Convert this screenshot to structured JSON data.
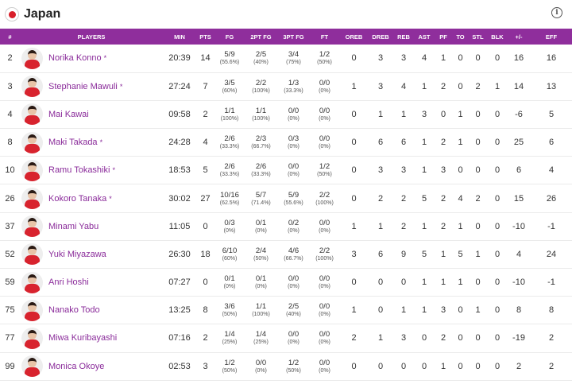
{
  "team": {
    "name": "Japan",
    "flag_icon": "japan-flag-icon",
    "flag_color": "#d81f2a"
  },
  "info_glyph": "i",
  "accent_color": "#8f2e9c",
  "headers": [
    "#",
    "PLAYERS",
    "MIN",
    "PTS",
    "FG",
    "2PT FG",
    "3PT FG",
    "FT",
    "OREB",
    "DREB",
    "REB",
    "AST",
    "PF",
    "TO",
    "STL",
    "BLK",
    "+/-",
    "EFF"
  ],
  "rows": [
    {
      "num": "2",
      "name": "Norika Konno",
      "starter": "*",
      "min": "20:39",
      "pts": "14",
      "fg": "5/9",
      "fg_pct": "(55.6%)",
      "fg2": "2/5",
      "fg2_pct": "(40%)",
      "fg3": "3/4",
      "fg3_pct": "(75%)",
      "ft": "1/2",
      "ft_pct": "(50%)",
      "oreb": "0",
      "dreb": "3",
      "reb": "3",
      "ast": "4",
      "pf": "1",
      "to": "0",
      "stl": "0",
      "blk": "0",
      "pm": "16",
      "eff": "16"
    },
    {
      "num": "3",
      "name": "Stephanie Mawuli",
      "starter": "*",
      "min": "27:24",
      "pts": "7",
      "fg": "3/5",
      "fg_pct": "(60%)",
      "fg2": "2/2",
      "fg2_pct": "(100%)",
      "fg3": "1/3",
      "fg3_pct": "(33.3%)",
      "ft": "0/0",
      "ft_pct": "(0%)",
      "oreb": "1",
      "dreb": "3",
      "reb": "4",
      "ast": "1",
      "pf": "2",
      "to": "0",
      "stl": "2",
      "blk": "1",
      "pm": "14",
      "eff": "13"
    },
    {
      "num": "4",
      "name": "Mai Kawai",
      "starter": "",
      "min": "09:58",
      "pts": "2",
      "fg": "1/1",
      "fg_pct": "(100%)",
      "fg2": "1/1",
      "fg2_pct": "(100%)",
      "fg3": "0/0",
      "fg3_pct": "(0%)",
      "ft": "0/0",
      "ft_pct": "(0%)",
      "oreb": "0",
      "dreb": "1",
      "reb": "1",
      "ast": "3",
      "pf": "0",
      "to": "1",
      "stl": "0",
      "blk": "0",
      "pm": "-6",
      "eff": "5"
    },
    {
      "num": "8",
      "name": "Maki Takada",
      "starter": "*",
      "min": "24:28",
      "pts": "4",
      "fg": "2/6",
      "fg_pct": "(33.3%)",
      "fg2": "2/3",
      "fg2_pct": "(66.7%)",
      "fg3": "0/3",
      "fg3_pct": "(0%)",
      "ft": "0/0",
      "ft_pct": "(0%)",
      "oreb": "0",
      "dreb": "6",
      "reb": "6",
      "ast": "1",
      "pf": "2",
      "to": "1",
      "stl": "0",
      "blk": "0",
      "pm": "25",
      "eff": "6"
    },
    {
      "num": "10",
      "name": "Ramu Tokashiki",
      "starter": "*",
      "min": "18:53",
      "pts": "5",
      "fg": "2/6",
      "fg_pct": "(33.3%)",
      "fg2": "2/6",
      "fg2_pct": "(33.3%)",
      "fg3": "0/0",
      "fg3_pct": "(0%)",
      "ft": "1/2",
      "ft_pct": "(50%)",
      "oreb": "0",
      "dreb": "3",
      "reb": "3",
      "ast": "1",
      "pf": "3",
      "to": "0",
      "stl": "0",
      "blk": "0",
      "pm": "6",
      "eff": "4"
    },
    {
      "num": "26",
      "name": "Kokoro Tanaka",
      "starter": "*",
      "min": "30:02",
      "pts": "27",
      "fg": "10/16",
      "fg_pct": "(62.5%)",
      "fg2": "5/7",
      "fg2_pct": "(71.4%)",
      "fg3": "5/9",
      "fg3_pct": "(55.6%)",
      "ft": "2/2",
      "ft_pct": "(100%)",
      "oreb": "0",
      "dreb": "2",
      "reb": "2",
      "ast": "5",
      "pf": "2",
      "to": "4",
      "stl": "2",
      "blk": "0",
      "pm": "15",
      "eff": "26"
    },
    {
      "num": "37",
      "name": "Minami Yabu",
      "starter": "",
      "min": "11:05",
      "pts": "0",
      "fg": "0/3",
      "fg_pct": "(0%)",
      "fg2": "0/1",
      "fg2_pct": "(0%)",
      "fg3": "0/2",
      "fg3_pct": "(0%)",
      "ft": "0/0",
      "ft_pct": "(0%)",
      "oreb": "1",
      "dreb": "1",
      "reb": "2",
      "ast": "1",
      "pf": "2",
      "to": "1",
      "stl": "0",
      "blk": "0",
      "pm": "-10",
      "eff": "-1"
    },
    {
      "num": "52",
      "name": "Yuki Miyazawa",
      "starter": "",
      "min": "26:30",
      "pts": "18",
      "fg": "6/10",
      "fg_pct": "(60%)",
      "fg2": "2/4",
      "fg2_pct": "(50%)",
      "fg3": "4/6",
      "fg3_pct": "(66.7%)",
      "ft": "2/2",
      "ft_pct": "(100%)",
      "oreb": "3",
      "dreb": "6",
      "reb": "9",
      "ast": "5",
      "pf": "1",
      "to": "5",
      "stl": "1",
      "blk": "0",
      "pm": "4",
      "eff": "24"
    },
    {
      "num": "59",
      "name": "Anri Hoshi",
      "starter": "",
      "min": "07:27",
      "pts": "0",
      "fg": "0/1",
      "fg_pct": "(0%)",
      "fg2": "0/1",
      "fg2_pct": "(0%)",
      "fg3": "0/0",
      "fg3_pct": "(0%)",
      "ft": "0/0",
      "ft_pct": "(0%)",
      "oreb": "0",
      "dreb": "0",
      "reb": "0",
      "ast": "1",
      "pf": "1",
      "to": "1",
      "stl": "0",
      "blk": "0",
      "pm": "-10",
      "eff": "-1"
    },
    {
      "num": "75",
      "name": "Nanako Todo",
      "starter": "",
      "min": "13:25",
      "pts": "8",
      "fg": "3/6",
      "fg_pct": "(50%)",
      "fg2": "1/1",
      "fg2_pct": "(100%)",
      "fg3": "2/5",
      "fg3_pct": "(40%)",
      "ft": "0/0",
      "ft_pct": "(0%)",
      "oreb": "1",
      "dreb": "0",
      "reb": "1",
      "ast": "1",
      "pf": "3",
      "to": "0",
      "stl": "1",
      "blk": "0",
      "pm": "8",
      "eff": "8"
    },
    {
      "num": "77",
      "name": "Miwa Kuribayashi",
      "starter": "",
      "min": "07:16",
      "pts": "2",
      "fg": "1/4",
      "fg_pct": "(25%)",
      "fg2": "1/4",
      "fg2_pct": "(25%)",
      "fg3": "0/0",
      "fg3_pct": "(0%)",
      "ft": "0/0",
      "ft_pct": "(0%)",
      "oreb": "2",
      "dreb": "1",
      "reb": "3",
      "ast": "0",
      "pf": "2",
      "to": "0",
      "stl": "0",
      "blk": "0",
      "pm": "-19",
      "eff": "2"
    },
    {
      "num": "99",
      "name": "Monica Okoye",
      "starter": "",
      "min": "02:53",
      "pts": "3",
      "fg": "1/2",
      "fg_pct": "(50%)",
      "fg2": "0/0",
      "fg2_pct": "(0%)",
      "fg3": "1/2",
      "fg3_pct": "(50%)",
      "ft": "0/0",
      "ft_pct": "(0%)",
      "oreb": "0",
      "dreb": "0",
      "reb": "0",
      "ast": "0",
      "pf": "1",
      "to": "0",
      "stl": "0",
      "blk": "0",
      "pm": "2",
      "eff": "2"
    }
  ]
}
